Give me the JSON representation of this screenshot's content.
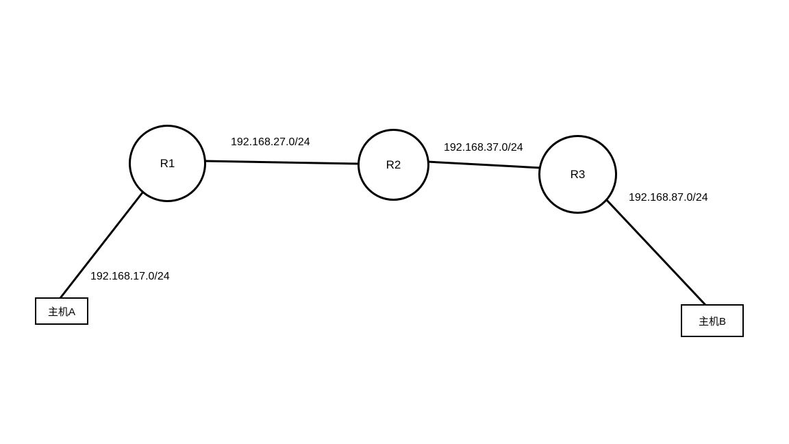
{
  "routers": {
    "r1": {
      "label": "R1"
    },
    "r2": {
      "label": "R2"
    },
    "r3": {
      "label": "R3"
    }
  },
  "hosts": {
    "a": {
      "label": "主机A"
    },
    "b": {
      "label": "主机B"
    }
  },
  "links": {
    "a_r1": {
      "subnet": "192.168.17.0/24"
    },
    "r1_r2": {
      "subnet": "192.168.27.0/24"
    },
    "r2_r3": {
      "subnet": "192.168.37.0/24"
    },
    "r3_b": {
      "subnet": "192.168.87.0/24"
    }
  },
  "chart_data": {
    "type": "network-diagram",
    "nodes": [
      {
        "id": "HostA",
        "type": "host",
        "label": "主机A"
      },
      {
        "id": "R1",
        "type": "router",
        "label": "R1"
      },
      {
        "id": "R2",
        "type": "router",
        "label": "R2"
      },
      {
        "id": "R3",
        "type": "router",
        "label": "R3"
      },
      {
        "id": "HostB",
        "type": "host",
        "label": "主机B"
      }
    ],
    "edges": [
      {
        "from": "HostA",
        "to": "R1",
        "subnet": "192.168.17.0/24"
      },
      {
        "from": "R1",
        "to": "R2",
        "subnet": "192.168.27.0/24"
      },
      {
        "from": "R2",
        "to": "R3",
        "subnet": "192.168.37.0/24"
      },
      {
        "from": "R3",
        "to": "HostB",
        "subnet": "192.168.87.0/24"
      }
    ]
  }
}
